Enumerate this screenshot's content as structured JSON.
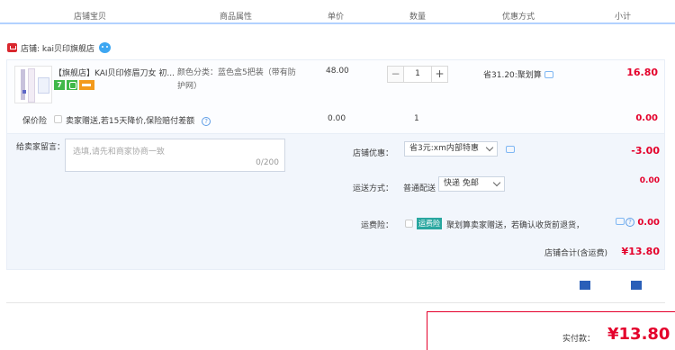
{
  "header": {
    "columns": [
      "店铺宝贝",
      "商品属性",
      "单价",
      "数量",
      "优惠方式",
      "小计"
    ]
  },
  "shop": {
    "label": "店铺: kai贝印旗舰店"
  },
  "item": {
    "title": "【旗舰店】KAI贝印修眉刀女 初...",
    "badge_text": "7",
    "sku_line1": "颜色分类：蓝色盒5把装（带有防",
    "sku_line2": "护网）",
    "unit_price": "48.00",
    "quantity": "1",
    "minus_label": "−",
    "plus_label": "+",
    "discount": "省31.20:聚划算",
    "subtotal": "16.80"
  },
  "insurance": {
    "label": "保价险",
    "text": "卖家赠送,若15天降价,保险赔付差额",
    "help": "?",
    "price": "0.00",
    "quantity": "1",
    "subtotal": "0.00"
  },
  "message": {
    "label": "给卖家留言：",
    "placeholder": "选填,请先和商家协商一致",
    "count": "0/200"
  },
  "shop_discount": {
    "label": "店铺优惠：",
    "selected": "省3元:xm内部特惠",
    "value": "-3.00"
  },
  "shipping": {
    "label": "运送方式：",
    "method_text": "普通配送",
    "selected": "快递 免邮",
    "value": "0.00"
  },
  "freight_insurance": {
    "label": "运费险：",
    "tag": "运费险",
    "text": "聚划算卖家赠送，若确认收货前退货，可获...",
    "value": "0.00"
  },
  "shop_total": {
    "label": "店铺合计(含运费)",
    "value": "¥13.80"
  },
  "payment": {
    "label": "实付款：",
    "value": "¥13.80"
  },
  "colors": {
    "price_red": "#e4002b",
    "accent_blue": "#3ea7f2",
    "tag_teal": "#2aa7a0"
  }
}
